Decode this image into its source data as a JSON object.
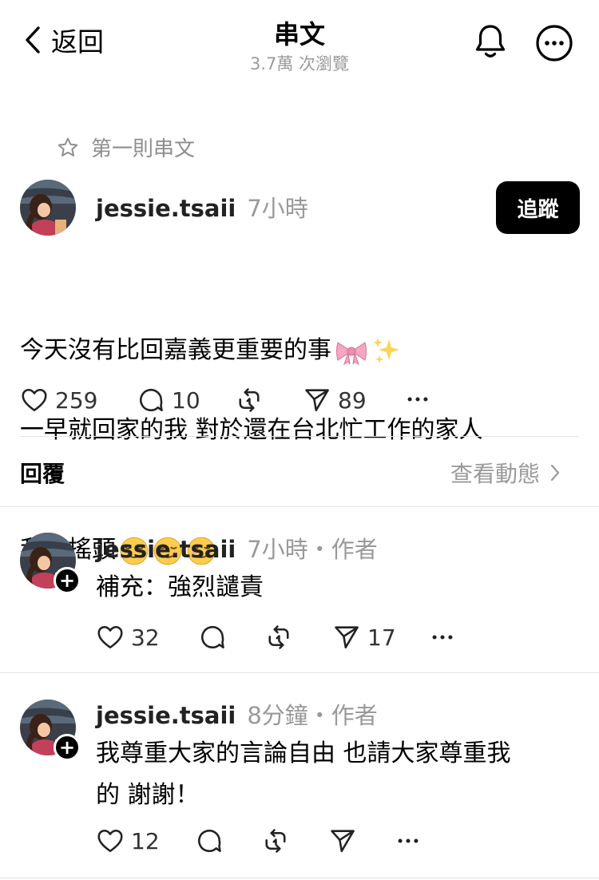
{
  "header": {
    "back_label": "返回",
    "title": "串文",
    "subtitle": "3.7萬 次瀏覽"
  },
  "thread": {
    "first_label": "第一則串文",
    "post": {
      "username": "jessie.tsaii",
      "time": "7小時",
      "follow_label": "追蹤",
      "line1": "今天沒有比回嘉義更重要的事",
      "line2": "一早就回家的我 對於還在台北忙工作的家人",
      "line3": "我直搖頭",
      "likes": "259",
      "comments": "10",
      "shares": "89"
    }
  },
  "replies": {
    "label": "回覆",
    "view_activity": "查看動態",
    "items": [
      {
        "username": "jessie.tsaii",
        "meta": "7小時・作者",
        "text": "補充：強烈譴責",
        "likes": "32",
        "shares": "17"
      },
      {
        "username": "jessie.tsaii",
        "meta": "8分鐘・作者",
        "text_line1": "我尊重大家的言論自由 也請大家尊重我",
        "text_line2": "的 謝謝！",
        "likes": "12"
      }
    ]
  }
}
